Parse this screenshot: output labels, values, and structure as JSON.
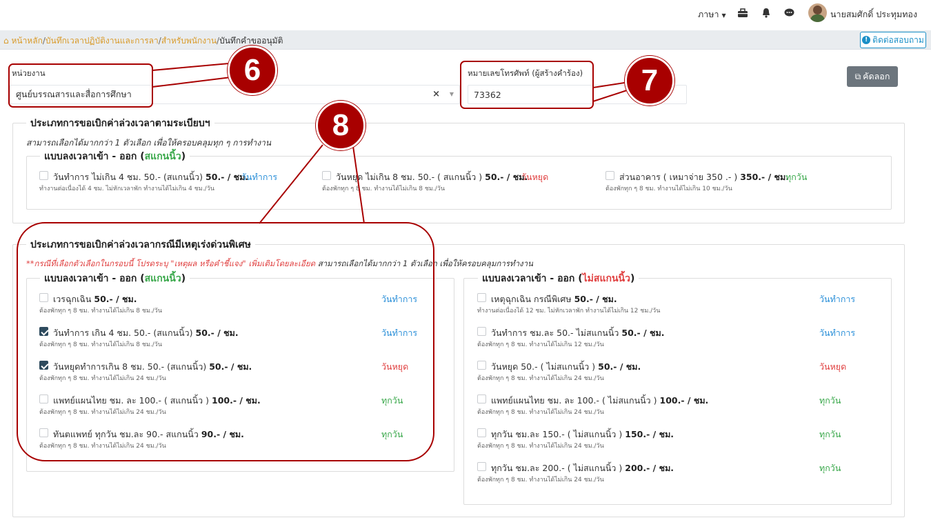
{
  "topbar": {
    "language": "ภาษา",
    "user_name": "นายสมศักดิ์ ประทุมทอง"
  },
  "breadcrumb": {
    "items": [
      "หน้าหลัก",
      "บันทึกเวลาปฏิบัติงานและการลา",
      "สำหรับพนักงาน",
      "บันทึกคำขออนุมัติ"
    ],
    "separator": "/",
    "contact_label": "ติดต่อสอบถาม"
  },
  "form": {
    "unit_label": "หน่วยงาน",
    "unit_value": "ศูนย์บรรณสารและสื่อการศึกษา",
    "clear_symbol": "×",
    "phone_label": "หมายเลขโทรศัพท์ (ผู้สร้างคำร้อง)",
    "phone_value": "73362",
    "copy_label": "คัดลอก"
  },
  "regular": {
    "title": "ประเภทการขอเบิกค่าล่วงเวลาตามระเบียบฯ",
    "note": "สามารถเลือกได้มากกว่า 1 ตัวเลือก เพื่อให้ครอบคลุมทุก ๆ การทำงาน",
    "subsection_prefix": "แบบลงเวลาเข้า - ออก (",
    "subsection_highlight": "สแกนนิ้ว",
    "subsection_suffix": ")",
    "options": [
      {
        "label": "วันทำการ ไม่เกิน 4 ชม. 50.- (สแกนนิ้ว)",
        "rate": "50.- / ชม.",
        "tag": "วันทำการ",
        "desc": "ทำงานต่อเนื่องได้ 4 ชม. ไม่หักเวลาพัก ทำงานได้ไม่เกิน 4 ชม./วัน",
        "checked": false
      },
      {
        "label": "วันหยุด ไม่เกิน 8 ชม. 50.- ( สแกนนิ้ว )",
        "rate": "50.- / ชม.",
        "tag": "วันหยุด",
        "desc": "ต้องพักทุก ๆ 8 ชม. ทำงานได้ไม่เกิน 8 ชม./วัน",
        "checked": false
      },
      {
        "label": "ส่วนอาคาร ( เหมาจ่าย 350 .- )",
        "rate": "350.- / ชม.",
        "tag": "ทุกวัน",
        "desc": "ต้องพักทุก ๆ 8 ชม. ทำงานได้ไม่เกิน 10 ชม./วัน",
        "checked": false
      }
    ]
  },
  "special": {
    "title": "ประเภทการขอเบิกค่าล่วงเวลากรณีมีเหตุเร่งด่วนพิเศษ",
    "note_red": "**กรณีที่เลือกตัวเลือกในกรอบนี้ โปรดระบุ \"เหตุผล หรือคำชี้แจง\" เพิ่มเติมโดยละเอียด",
    "note_rest": "สามารถเลือกได้มากกว่า 1 ตัวเลือก เพื่อให้ครอบคลุมการทำงาน",
    "left_prefix": "แบบลงเวลาเข้า - ออก (",
    "left_highlight": "สแกนนิ้ว",
    "left_suffix": ")",
    "right_prefix": "แบบลงเวลาเข้า - ออก (",
    "right_highlight": "ไม่สแกนนิ้ว",
    "right_suffix": ")",
    "left": [
      {
        "label": "เวรฉุกเฉิน",
        "rate": "50.- / ชม.",
        "tag": "วันทำการ",
        "desc": "ต้องพักทุก ๆ 8 ชม. ทำงานได้ไม่เกิน 8 ชม./วัน",
        "checked": false
      },
      {
        "label": "วันทำการ เกิน 4 ชม. 50.- (สแกนนิ้ว)",
        "rate": "50.- / ชม.",
        "tag": "วันทำการ",
        "desc": "ต้องพักทุก ๆ 8 ชม. ทำงานได้ไม่เกิน 8 ชม./วัน",
        "checked": true
      },
      {
        "label": "วันหยุดทำการเกิน 8 ชม. 50.- (สแกนนิ้ว)",
        "rate": "50.- / ชม.",
        "tag": "วันหยุด",
        "desc": "ต้องพักทุก ๆ 8 ชม. ทำงานได้ไม่เกิน 24 ชม./วัน",
        "checked": true
      },
      {
        "label": "แพทย์แผนไทย ชม. ละ 100.- ( สแกนนิ้ว )",
        "rate": "100.- / ชม.",
        "tag": "ทุกวัน",
        "desc": "ต้องพักทุก ๆ 8 ชม. ทำงานได้ไม่เกิน 24 ชม./วัน",
        "checked": false
      },
      {
        "label": "ทันตแพทย์ ทุกวัน ชม.ละ 90.- สแกนนิ้ว",
        "rate": "90.- / ชม.",
        "tag": "ทุกวัน",
        "desc": "ต้องพักทุก ๆ 8 ชม. ทำงานได้ไม่เกิน 24 ชม./วัน",
        "checked": false
      }
    ],
    "right": [
      {
        "label": "เหตุฉุกเฉิน กรณีพิเศษ",
        "rate": "50.- / ชม.",
        "tag": "วันทำการ",
        "desc": "ทำงานต่อเนื่องได้ 12 ชม. ไม่หักเวลาพัก ทำงานได้ไม่เกิน 12 ชม./วัน",
        "checked": false
      },
      {
        "label": "วันทำการ ชม.ละ 50.- ไม่สแกนนิ้ว",
        "rate": "50.- / ชม.",
        "tag": "วันทำการ",
        "desc": "ต้องพักทุก ๆ 8 ชม. ทำงานได้ไม่เกิน 12 ชม./วัน",
        "checked": false
      },
      {
        "label": "วันหยุด 50.- ( ไม่สแกนนิ้ว )",
        "rate": "50.- / ชม.",
        "tag": "วันหยุด",
        "desc": "ต้องพักทุก ๆ 8 ชม. ทำงานได้ไม่เกิน 24 ชม./วัน",
        "checked": false
      },
      {
        "label": "แพทย์แผนไทย ชม. ละ 100.- ( ไม่สแกนนิ้ว )",
        "rate": "100.- / ชม.",
        "tag": "ทุกวัน",
        "desc": "ต้องพักทุก ๆ 8 ชม. ทำงานได้ไม่เกิน 24 ชม./วัน",
        "checked": false
      },
      {
        "label": "ทุกวัน ชม.ละ 150.- ( ไม่สแกนนิ้ว )",
        "rate": "150.- / ชม.",
        "tag": "ทุกวัน",
        "desc": "ต้องพักทุก ๆ 8 ชม. ทำงานได้ไม่เกิน 24 ชม./วัน",
        "checked": false
      },
      {
        "label": "ทุกวัน ชม.ละ 200.- ( ไม่สแกนนิ้ว )",
        "rate": "200.- / ชม.",
        "tag": "ทุกวัน",
        "desc": "ต้องพักทุก ๆ 8 ชม. ทำงานได้ไม่เกิน 24 ชม./วัน",
        "checked": false
      }
    ]
  },
  "annotations": {
    "badge_6": "6",
    "badge_7": "7",
    "badge_8": "8"
  },
  "colors": {
    "accent": "#d99b2b",
    "annotation": "#a80000",
    "link_blue": "#2a8fd8",
    "holiday_red": "#e04040",
    "daily_green": "#3aa84b"
  }
}
